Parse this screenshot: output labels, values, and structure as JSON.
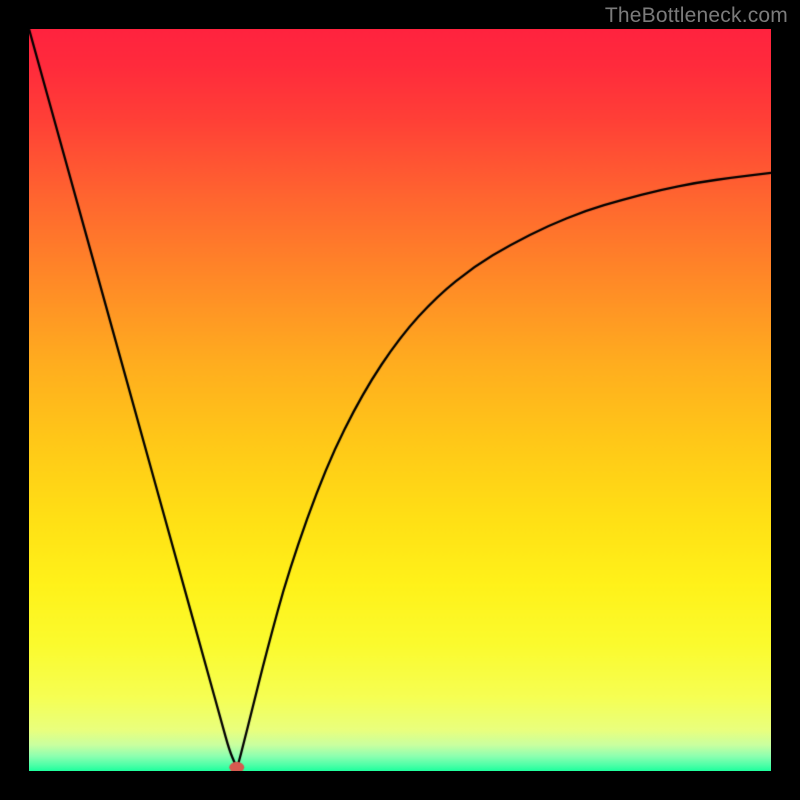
{
  "watermark": "TheBottleneck.com",
  "chart_data": {
    "type": "line",
    "title": "",
    "xlabel": "",
    "ylabel": "",
    "xlim": [
      0,
      100
    ],
    "ylim": [
      0,
      100
    ],
    "curve": {
      "x": [
        0,
        5,
        10,
        15,
        20,
        24,
        26,
        27,
        27.8,
        28.0,
        28.2,
        29,
        30,
        32,
        35,
        40,
        45,
        50,
        55,
        60,
        65,
        70,
        75,
        80,
        85,
        90,
        95,
        100
      ],
      "y": [
        100,
        82,
        64,
        46,
        28,
        13.6,
        6.4,
        2.8,
        0.9,
        0.5,
        0.9,
        4.0,
        8.0,
        16.0,
        27.0,
        41.0,
        51.0,
        58.5,
        64.0,
        68.0,
        71.0,
        73.5,
        75.5,
        77.0,
        78.3,
        79.3,
        80.0,
        80.6
      ]
    },
    "marker": {
      "x": 28.0,
      "y": 0.5,
      "color": "#d65a50"
    },
    "gradient": {
      "stops": [
        {
          "pos": 0.0,
          "color": "#ff233f"
        },
        {
          "pos": 0.05,
          "color": "#ff2b3c"
        },
        {
          "pos": 0.12,
          "color": "#ff3f37"
        },
        {
          "pos": 0.22,
          "color": "#ff6330"
        },
        {
          "pos": 0.34,
          "color": "#ff8a27"
        },
        {
          "pos": 0.45,
          "color": "#ffad1f"
        },
        {
          "pos": 0.56,
          "color": "#ffc918"
        },
        {
          "pos": 0.66,
          "color": "#ffe015"
        },
        {
          "pos": 0.75,
          "color": "#fff21a"
        },
        {
          "pos": 0.83,
          "color": "#fbfb2e"
        },
        {
          "pos": 0.9,
          "color": "#f6ff53"
        },
        {
          "pos": 0.945,
          "color": "#e9ff7e"
        },
        {
          "pos": 0.965,
          "color": "#c9ffa0"
        },
        {
          "pos": 0.98,
          "color": "#8dffb0"
        },
        {
          "pos": 0.992,
          "color": "#4effa8"
        },
        {
          "pos": 1.0,
          "color": "#1dff9d"
        }
      ]
    },
    "annotations": []
  }
}
